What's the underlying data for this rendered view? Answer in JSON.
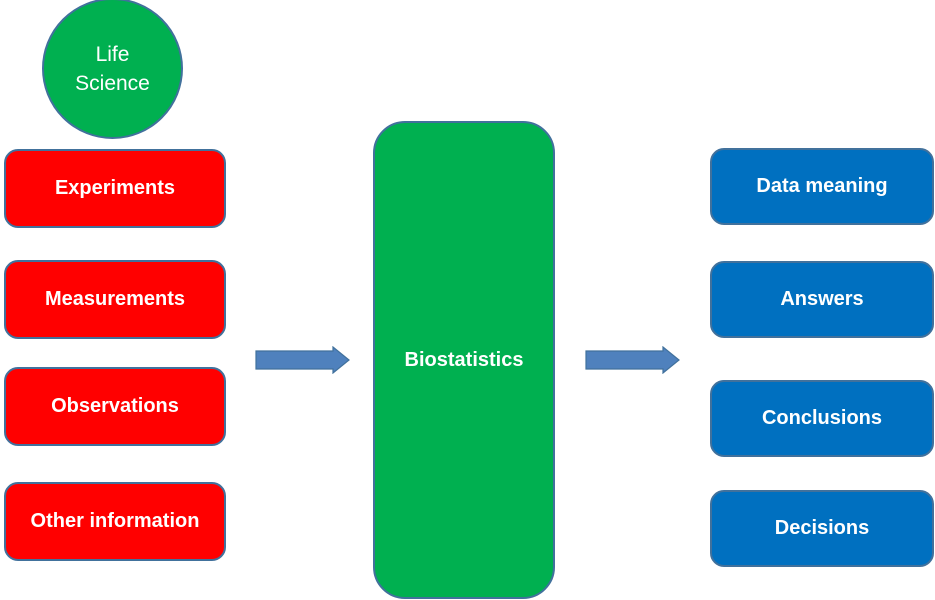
{
  "diagram": {
    "source_node": {
      "label_lines": [
        "Life",
        "Science"
      ]
    },
    "inputs": [
      {
        "label": "Experiments"
      },
      {
        "label": "Measurements"
      },
      {
        "label": "Observations"
      },
      {
        "label": "Other information"
      }
    ],
    "process": {
      "label": "Biostatistics"
    },
    "outputs": [
      {
        "label": "Data meaning"
      },
      {
        "label": "Answers"
      },
      {
        "label": "Conclusions"
      },
      {
        "label": "Decisions"
      }
    ],
    "edges": [
      {
        "from": "inputs",
        "to": "Biostatistics"
      },
      {
        "from": "Biostatistics",
        "to": "outputs"
      }
    ],
    "colors": {
      "source": "#00b050",
      "inputs": "#ff0000",
      "process": "#00b050",
      "outputs": "#0070c0",
      "arrows": "#4f81bd",
      "outline": "#41719c",
      "text": "#ffffff"
    }
  }
}
